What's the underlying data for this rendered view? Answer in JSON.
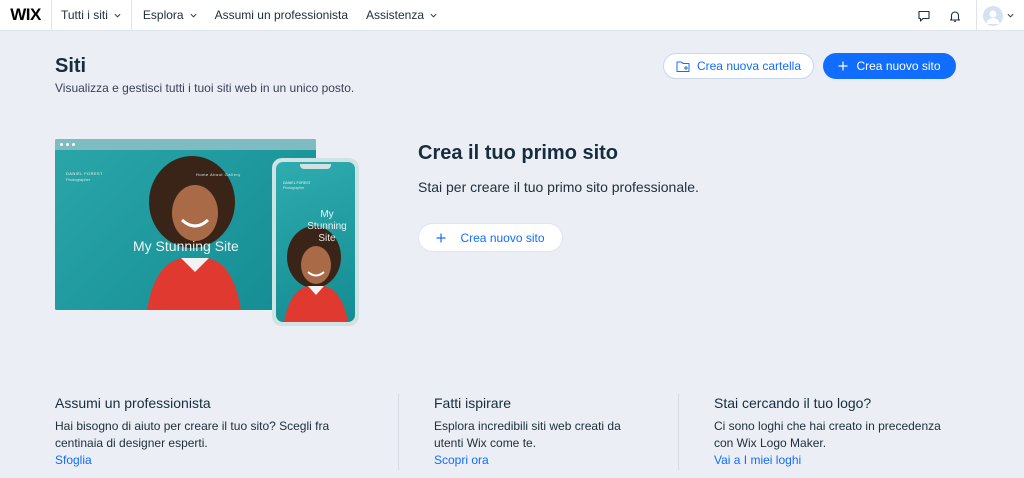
{
  "topbar": {
    "logo": "WIX",
    "nav": [
      "Tutti i siti",
      "Esplora",
      "Assumi un professionista",
      "Assistenza"
    ]
  },
  "header": {
    "title": "Siti",
    "subtitle": "Visualizza e gestisci tutti i tuoi siti web in un unico posto.",
    "new_folder_label": "Crea nuova cartella",
    "new_site_label": "Crea nuovo sito"
  },
  "hero": {
    "title": "Crea il tuo primo sito",
    "subtitle": "Stai per creare il tuo primo sito professionale.",
    "button_label": "Crea nuovo sito",
    "preview": {
      "name": "DANIEL FOREST",
      "role": "Photographer",
      "menu": "Home     About     Gallery",
      "site_title": "My Stunning Site",
      "phone_title": "My Stunning Site"
    }
  },
  "cards": [
    {
      "title": "Assumi un professionista",
      "text_lines": [
        "Hai bisogno di aiuto per creare il tuo sito? Scegli fra",
        "centinaia di designer esperti."
      ],
      "link": "Sfoglia"
    },
    {
      "title": "Fatti ispirare",
      "text_lines": [
        "Esplora incredibili siti web creati da",
        "utenti Wix come te."
      ],
      "link": "Scopri ora"
    },
    {
      "title": "Stai cercando il tuo logo?",
      "text_lines": [
        "Ci sono loghi che hai creato in precedenza",
        "con Wix Logo Maker."
      ],
      "link": "Vai a I miei loghi"
    }
  ],
  "colors": {
    "accent": "#116dff",
    "background": "#ebeef5",
    "text": "#162d3d"
  },
  "icons": [
    "chevron-down-icon",
    "chat-icon",
    "bell-icon",
    "avatar-icon",
    "folder-plus-icon",
    "plus-icon"
  ]
}
